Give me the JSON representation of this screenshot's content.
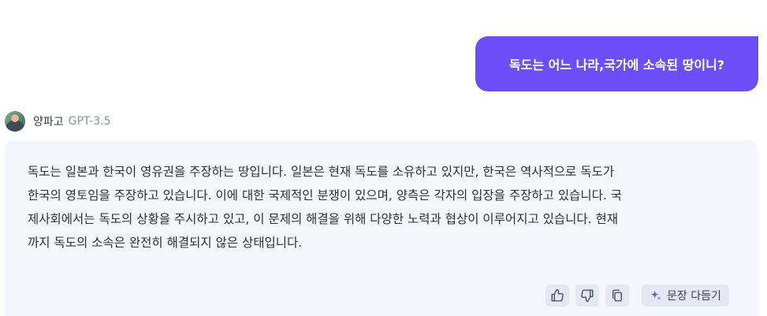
{
  "user_message": {
    "text": "독도는 어느 나라,국가에 소속된 땅이니?"
  },
  "assistant": {
    "name": "양파고",
    "model": "GPT-3.5",
    "avatar_icon": "avatar",
    "lines": [
      "독도는 일본과 한국이 영유권을 주장하는 땅입니다. 일본은 현재 독도를 소유하고 있지만, 한국은 역사적으로 독도가",
      "한국의 영토임을 주장하고 있습니다. 이에 대한 국제적인 분쟁이 있으며, 양측은 각자의 입장을 주장하고 있습니다. 국",
      "제사회에서는 독도의 상황을 주시하고 있고, 이 문제의 해결을 위해 다양한 노력과 협상이 이루어지고 있습니다. 현재",
      "까지 독도의 소속은 완전히 해결되지 않은 상태입니다."
    ]
  },
  "actions": {
    "like_icon": "thumbs-up-icon",
    "dislike_icon": "thumbs-down-icon",
    "copy_icon": "copy-icon",
    "refine_icon": "sparkle-icon",
    "refine_label": "문장 다듬기"
  },
  "colors": {
    "user_bubble": "#6b4ef6",
    "assistant_card": "#f3f6fd",
    "accent": "#6b4ef6"
  }
}
